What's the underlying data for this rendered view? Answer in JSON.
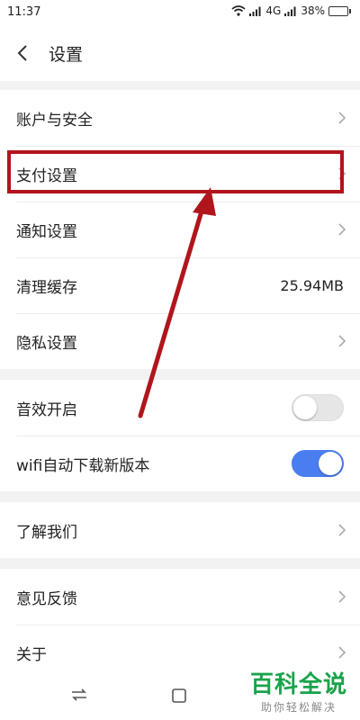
{
  "status": {
    "time": "11:37",
    "network": "4G",
    "battery": "38%",
    "battery_level": 0.38
  },
  "header": {
    "title": "设置"
  },
  "groups": [
    {
      "items": [
        {
          "label": "账户与安全"
        },
        {
          "label": "支付设置"
        },
        {
          "label": "通知设置"
        },
        {
          "label": "清理缓存",
          "value": "25.94MB"
        },
        {
          "label": "隐私设置"
        }
      ]
    },
    {
      "items": [
        {
          "label": "音效开启",
          "toggle": false
        },
        {
          "label": "wifi自动下载新版本",
          "toggle": true
        }
      ]
    },
    {
      "items": [
        {
          "label": "了解我们"
        }
      ]
    },
    {
      "items": [
        {
          "label": "意见反馈"
        },
        {
          "label": "关于"
        }
      ]
    }
  ],
  "watermark": {
    "brand": "百科全说",
    "sub": "助你轻松解决"
  },
  "colors": {
    "annotation": "#b1151c",
    "toggle_on": "#4a7ef0",
    "brand": "#1aa34a"
  }
}
